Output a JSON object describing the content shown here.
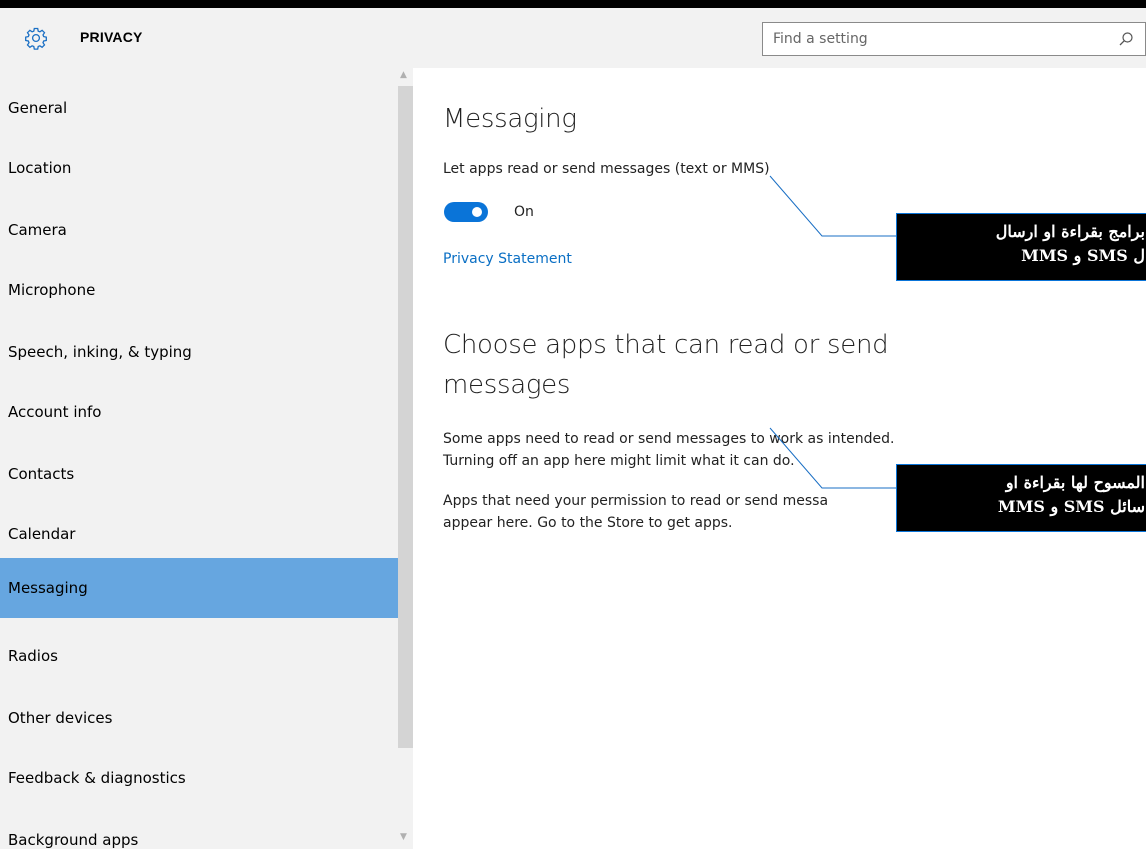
{
  "header": {
    "title": "PRIVACY",
    "search_placeholder": "Find a setting",
    "icon": "gear-icon",
    "search_icon": "search-icon"
  },
  "sidebar": {
    "items": [
      {
        "label": "General"
      },
      {
        "label": "Location"
      },
      {
        "label": "Camera"
      },
      {
        "label": "Microphone"
      },
      {
        "label": "Speech, inking, & typing"
      },
      {
        "label": "Account info"
      },
      {
        "label": "Contacts"
      },
      {
        "label": "Calendar"
      },
      {
        "label": "Messaging",
        "selected": true
      },
      {
        "label": "Radios"
      },
      {
        "label": "Other devices"
      },
      {
        "label": "Feedback & diagnostics"
      },
      {
        "label": "Background apps"
      }
    ],
    "selected_color": "#66a6e0"
  },
  "main": {
    "heading": "Messaging",
    "toggle_caption": "Let apps read or send messages (text or MMS)",
    "toggle_state": "On",
    "toggle_on": true,
    "privacy_link": "Privacy Statement",
    "section_heading_line1": "Choose apps that can read or send",
    "section_heading_line2": "messages",
    "description_line1": "Some apps need to read or send messages to work as intended.",
    "description_line2": "Turning off an app here might limit what it can do.",
    "info_line1": "Apps that need your permission to read or send messa",
    "info_line2": "appear here. Go to the Store to get apps."
  },
  "annotations": {
    "callout1_line1": "برامج بقراءة او ارسال",
    "callout1_line2": "ل SMS و MMS",
    "callout2_line1": "المسوح لها بقراءة او",
    "callout2_line2": "سائل SMS و MMS"
  },
  "colors": {
    "accent": "#0a74d8",
    "link": "#0a6fc4",
    "sidebar_bg": "#f2f2f2"
  }
}
